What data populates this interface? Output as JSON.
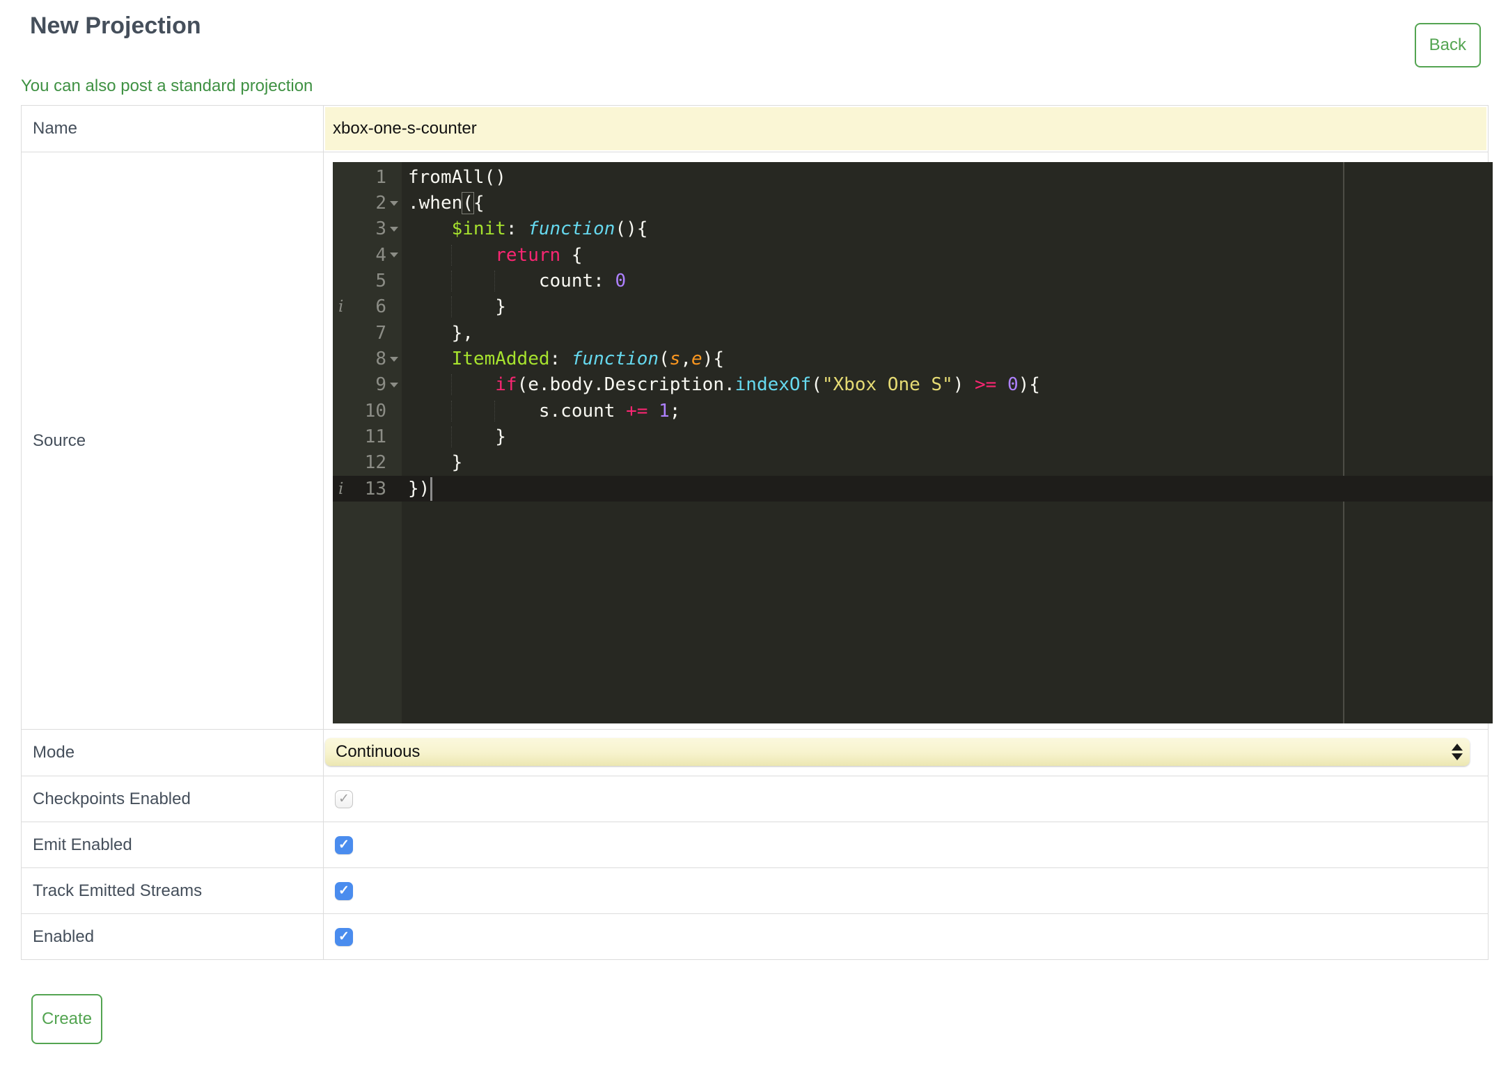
{
  "page": {
    "title": "New Projection",
    "back_button": "Back",
    "standard_projection_link": "You can also post a standard projection",
    "create_button": "Create"
  },
  "form": {
    "name": {
      "label": "Name",
      "value": "xbox-one-s-counter"
    },
    "source": {
      "label": "Source"
    },
    "mode": {
      "label": "Mode",
      "value": "Continuous"
    },
    "checkpoints": {
      "label": "Checkpoints Enabled",
      "checked": true,
      "disabled": true
    },
    "emit": {
      "label": "Emit Enabled",
      "checked": true,
      "disabled": false
    },
    "track": {
      "label": "Track Emitted Streams",
      "checked": true,
      "disabled": false
    },
    "enabled": {
      "label": "Enabled",
      "checked": true,
      "disabled": false
    }
  },
  "icons": {
    "checkbox_check": "✓",
    "info_glyph": "i",
    "fold_arrow": "triangle-down",
    "select_stepper": "up-down-arrows"
  },
  "colors": {
    "accent_green": "#3f9143",
    "button_green": "#53a451",
    "checkbox_blue": "#4a8cee",
    "field_yellow": "#faf6d5",
    "editor_background": "#272822",
    "gutter_background": "#2f3129",
    "heading_text": "#454f5b",
    "token_plain": "#f8f8f2",
    "token_keyword": "#f92672",
    "token_entity": "#a6e22e",
    "token_function": "#66d9ef",
    "token_argument": "#fd971f",
    "token_string": "#e6db74",
    "token_number": "#ae81ff"
  },
  "editor": {
    "active_line": 13,
    "cursor_line": 13,
    "annotations": {
      "info_lines": [
        6,
        13
      ],
      "fold_lines": [
        2,
        3,
        4,
        8,
        9
      ]
    },
    "lines": [
      {
        "n": 1,
        "indent": 0,
        "tokens": [
          [
            "p",
            "fromAll()"
          ]
        ]
      },
      {
        "n": 2,
        "indent": 0,
        "tokens": [
          [
            "p",
            ".when"
          ],
          [
            "pm",
            "("
          ],
          [
            "p",
            "{"
          ]
        ]
      },
      {
        "n": 3,
        "indent": 1,
        "tokens": [
          [
            "g",
            "$init"
          ],
          [
            "p",
            ": "
          ],
          [
            "f",
            "function"
          ],
          [
            "p",
            "(){"
          ]
        ]
      },
      {
        "n": 4,
        "indent": 2,
        "tokens": [
          [
            "k",
            "return"
          ],
          [
            "p",
            " {"
          ]
        ]
      },
      {
        "n": 5,
        "indent": 3,
        "tokens": [
          [
            "p",
            "count: "
          ],
          [
            "n",
            "0"
          ]
        ]
      },
      {
        "n": 6,
        "indent": 2,
        "tokens": [
          [
            "p",
            "}"
          ]
        ]
      },
      {
        "n": 7,
        "indent": 1,
        "tokens": [
          [
            "p",
            "},"
          ]
        ]
      },
      {
        "n": 8,
        "indent": 1,
        "tokens": [
          [
            "g",
            "ItemAdded"
          ],
          [
            "p",
            ": "
          ],
          [
            "f",
            "function"
          ],
          [
            "p",
            "("
          ],
          [
            "a",
            "s"
          ],
          [
            "p",
            ","
          ],
          [
            "a",
            "e"
          ],
          [
            "p",
            "){"
          ]
        ]
      },
      {
        "n": 9,
        "indent": 2,
        "tokens": [
          [
            "k",
            "if"
          ],
          [
            "p",
            "(e.body.Description."
          ],
          [
            "m",
            "indexOf"
          ],
          [
            "p",
            "("
          ],
          [
            "s",
            "\"Xbox One S\""
          ],
          [
            "p",
            ") "
          ],
          [
            "k",
            ">="
          ],
          [
            "p",
            " "
          ],
          [
            "n",
            "0"
          ],
          [
            "p",
            "){"
          ]
        ]
      },
      {
        "n": 10,
        "indent": 3,
        "tokens": [
          [
            "p",
            "s.count "
          ],
          [
            "k",
            "+="
          ],
          [
            "p",
            " "
          ],
          [
            "n",
            "1"
          ],
          [
            "p",
            ";"
          ]
        ]
      },
      {
        "n": 11,
        "indent": 2,
        "tokens": [
          [
            "p",
            "}"
          ]
        ]
      },
      {
        "n": 12,
        "indent": 1,
        "tokens": [
          [
            "p",
            "}"
          ]
        ]
      },
      {
        "n": 13,
        "indent": 0,
        "tokens": [
          [
            "p",
            "})"
          ]
        ]
      }
    ]
  }
}
